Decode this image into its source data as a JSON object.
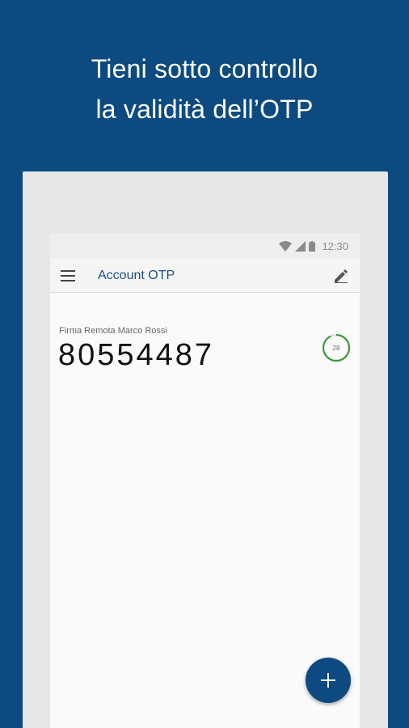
{
  "promo": {
    "line1": "Tieni sotto controllo",
    "line2": "la validità dell’OTP"
  },
  "status_bar": {
    "time": "12:30",
    "icons": [
      "wifi-icon",
      "signal-icon",
      "battery-icon"
    ]
  },
  "app_bar": {
    "title": "Account OTP",
    "menu_icon": "hamburger-menu-icon",
    "edit_icon": "pencil-icon"
  },
  "accounts": [
    {
      "name": "Firma Remota Marco Rossi",
      "otp": "80554487",
      "seconds_remaining": "28",
      "timer_fraction": 0.93
    }
  ],
  "fab": {
    "icon": "plus-icon"
  },
  "colors": {
    "background": "#0c4a80",
    "accent": "#1a4e86",
    "timer_ring": "#3a9a3a"
  }
}
